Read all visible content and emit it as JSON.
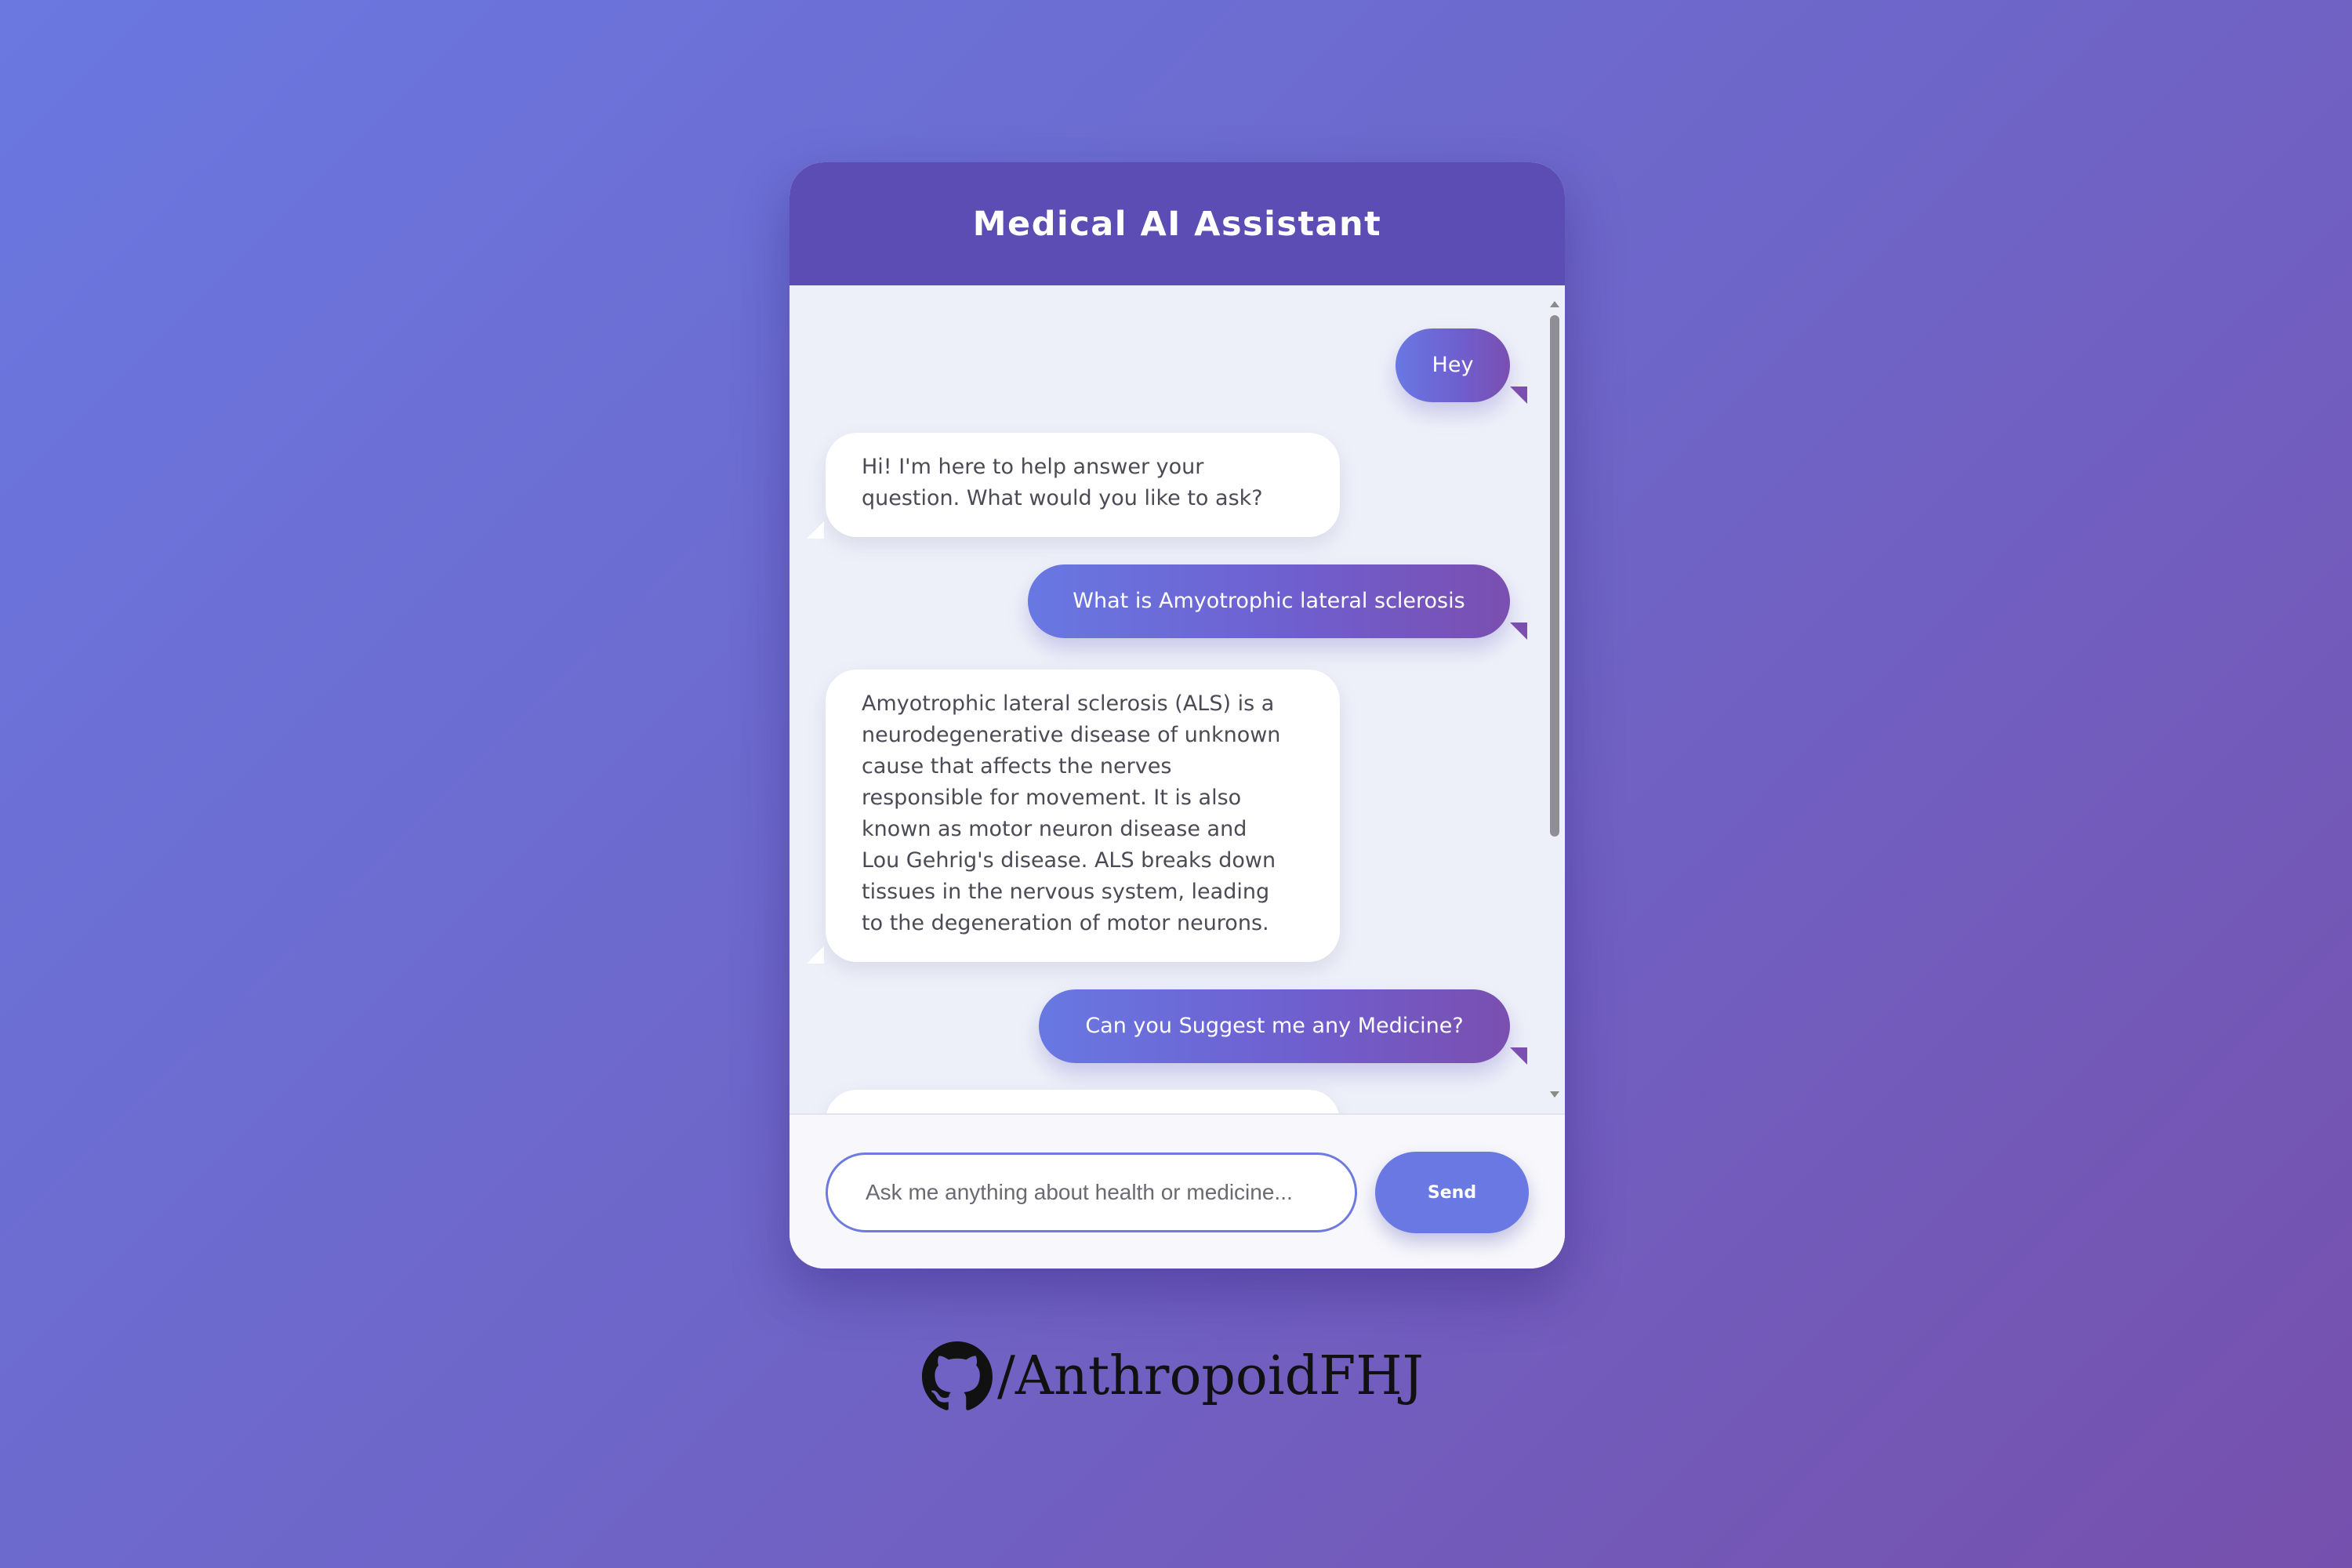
{
  "header": {
    "title": "Medical AI Assistant"
  },
  "messages": [
    {
      "role": "user",
      "text": "Hey"
    },
    {
      "role": "bot",
      "lines": [
        "Hi! I'm here to help answer your",
        "question. What would you like to ask?"
      ]
    },
    {
      "role": "user",
      "text": "What is Amyotrophic lateral sclerosis"
    },
    {
      "role": "bot",
      "lines": [
        "Amyotrophic lateral sclerosis (ALS) is a",
        "neurodegenerative disease of unknown",
        "cause that affects the nerves",
        "responsible for movement. It is also",
        "known as motor neuron disease and",
        "Lou Gehrig's disease. ALS breaks down",
        "tissues in the nervous system, leading",
        "to the degeneration of motor neurons."
      ]
    },
    {
      "role": "user",
      "text": "Can you Suggest me any Medicine?"
    }
  ],
  "composer": {
    "placeholder": "Ask me anything about health or medicine...",
    "value": "",
    "send_label": "Send"
  },
  "credit": {
    "icon": "github-icon",
    "text": "/AnthropoidFHJ"
  },
  "colors": {
    "header": "#5b4db3",
    "user_bubble_start": "#6878e2",
    "user_bubble_end": "#7a4fb0",
    "send_button": "#6a78e3",
    "input_border": "#6e7ae0"
  }
}
